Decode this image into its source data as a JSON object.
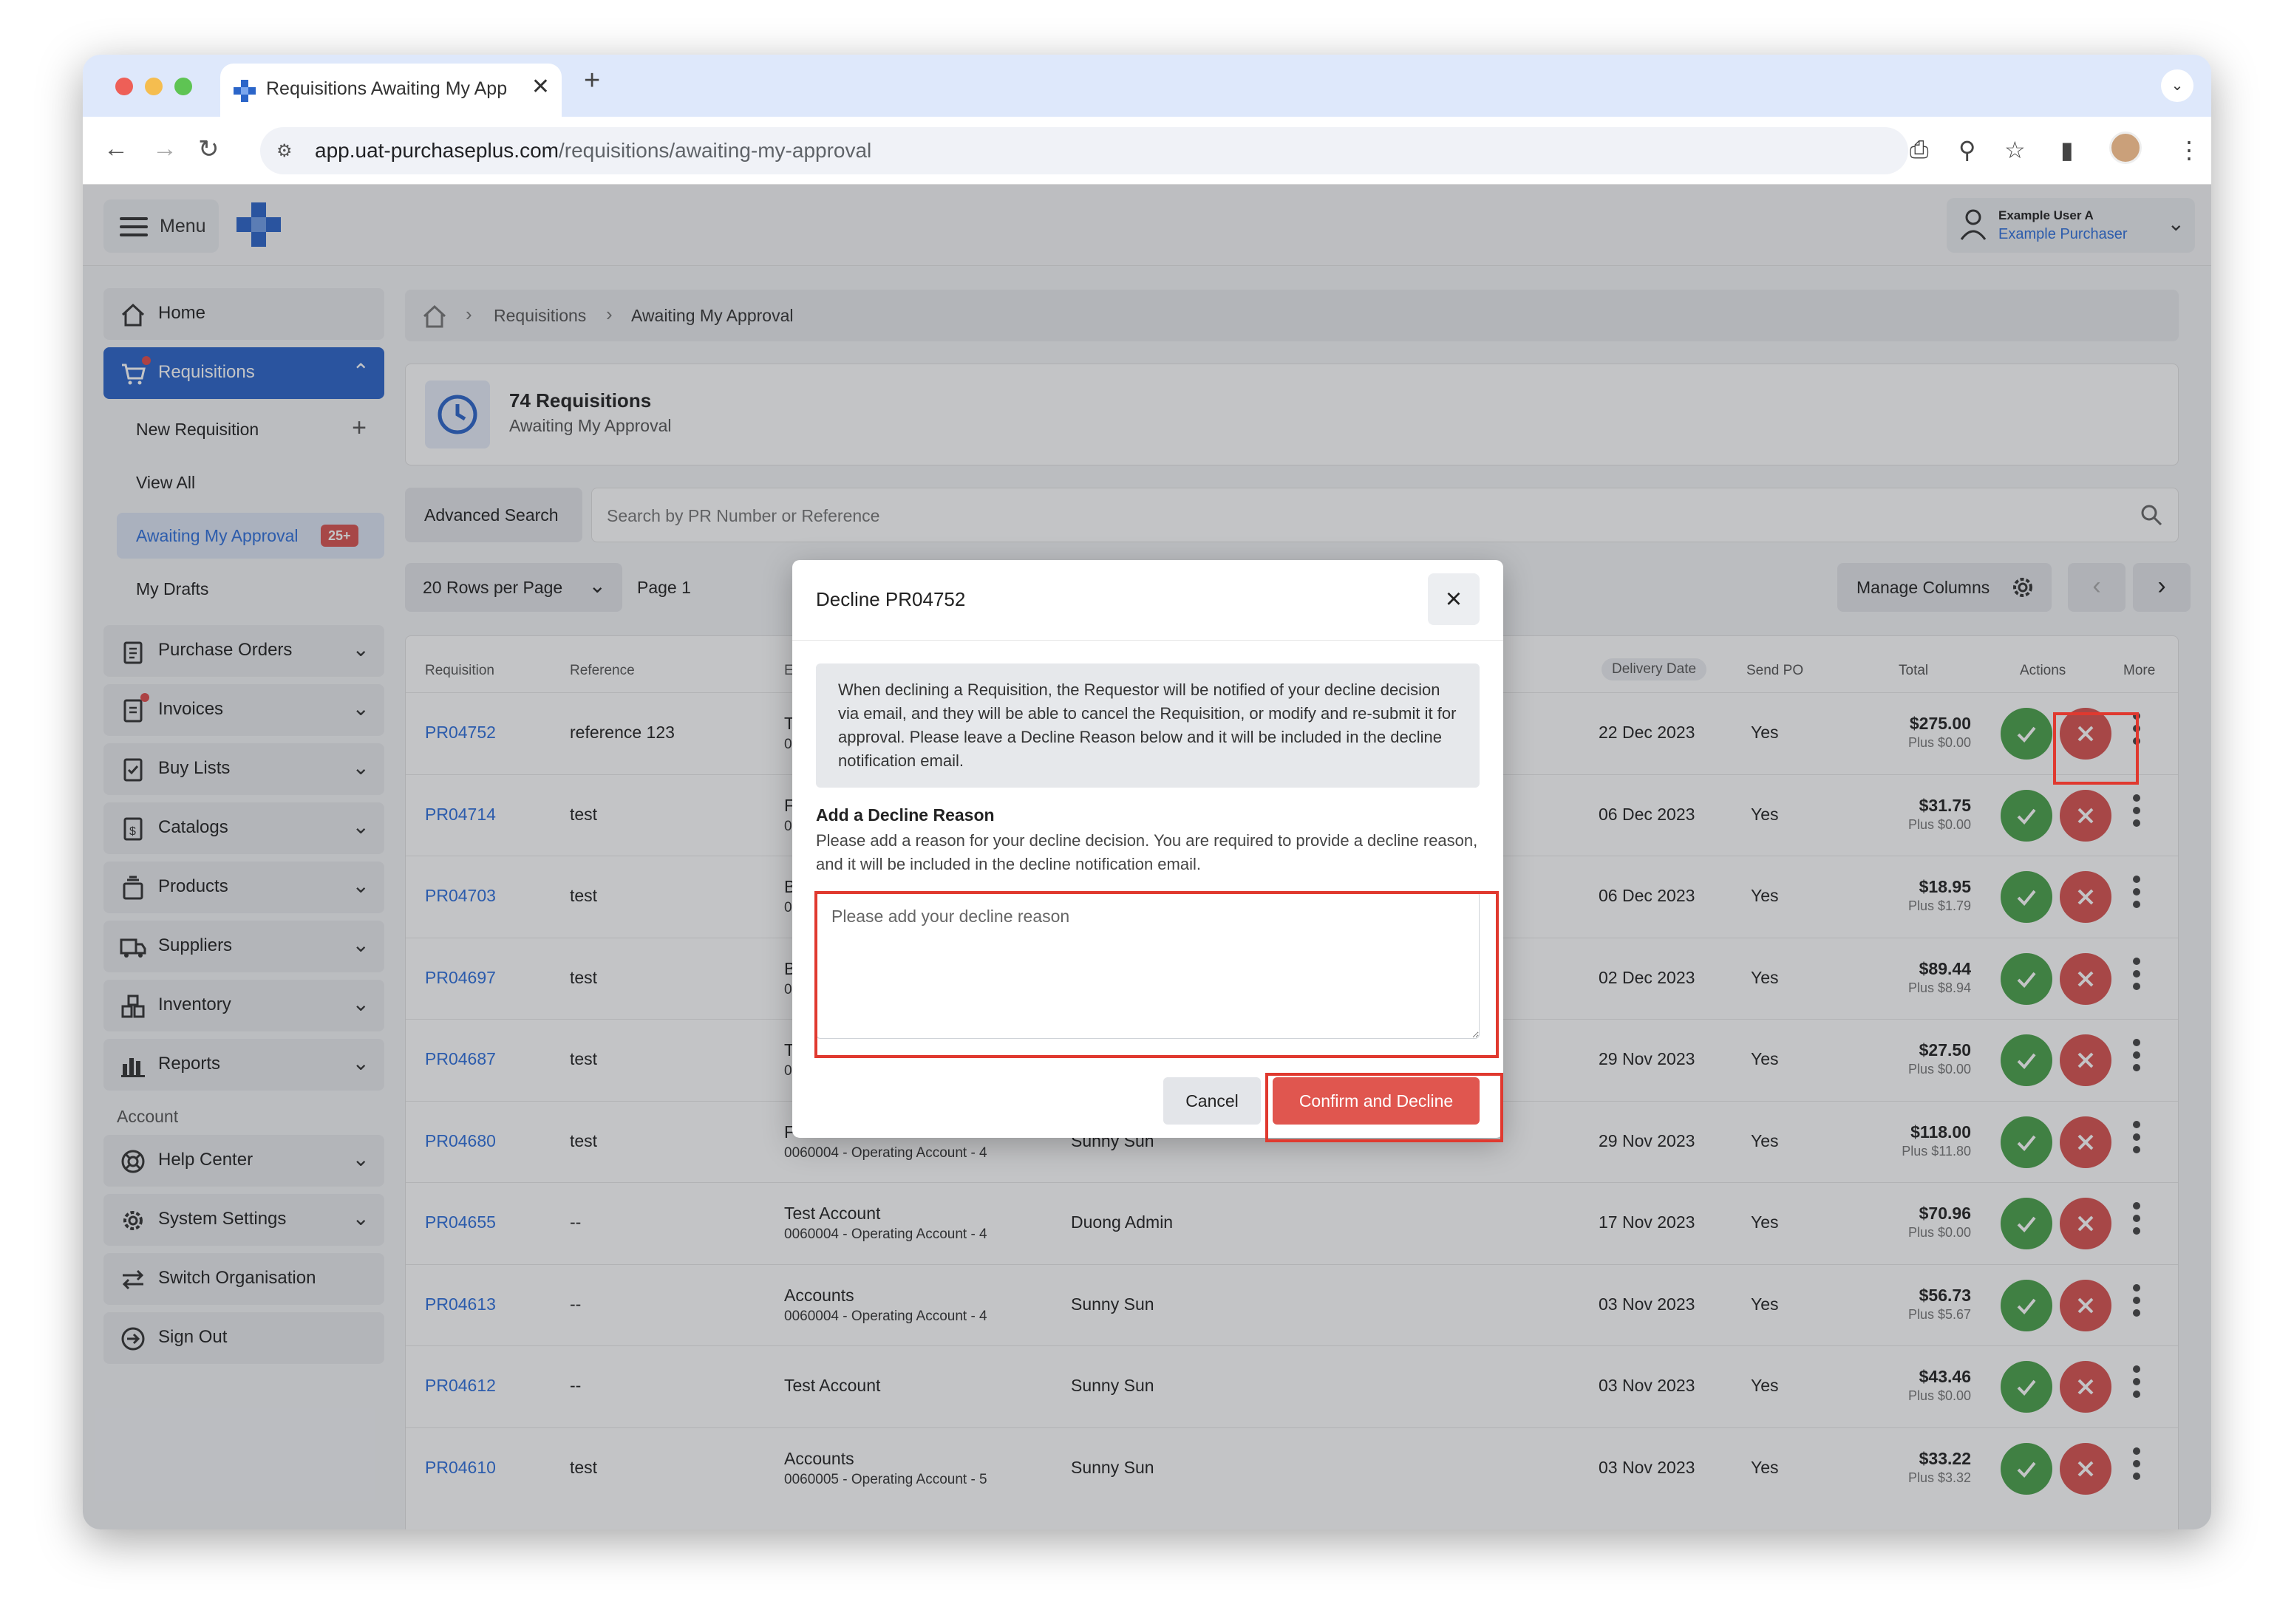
{
  "browser": {
    "tab_title": "Requisitions Awaiting My App",
    "url_domain": "app.uat-purchaseplus.com",
    "url_path": "/requisitions/awaiting-my-approval"
  },
  "header": {
    "menu_label": "Menu",
    "user_name": "Example User A",
    "user_role": "Example Purchaser"
  },
  "sidebar": {
    "home": "Home",
    "requisitions": "Requisitions",
    "new_requisition": "New Requisition",
    "view_all": "View All",
    "awaiting": "Awaiting My Approval",
    "awaiting_badge": "25+",
    "my_drafts": "My Drafts",
    "purchase_orders": "Purchase Orders",
    "invoices": "Invoices",
    "buy_lists": "Buy Lists",
    "catalogs": "Catalogs",
    "products": "Products",
    "suppliers": "Suppliers",
    "inventory": "Inventory",
    "reports": "Reports",
    "account_label": "Account",
    "help_center": "Help Center",
    "system_settings": "System Settings",
    "switch_org": "Switch Organisation",
    "sign_out": "Sign Out"
  },
  "breadcrumb": {
    "level1": "Requisitions",
    "level2": "Awaiting My Approval"
  },
  "summary": {
    "title": "74 Requisitions",
    "subtitle": "Awaiting My Approval"
  },
  "toolbar": {
    "advanced_search": "Advanced Search",
    "search_placeholder": "Search by PR Number or Reference",
    "rows_per_page": "20 Rows per Page",
    "page": "Page 1",
    "manage_columns": "Manage Columns"
  },
  "table": {
    "headers": {
      "requisition": "Requisition",
      "reference": "Reference",
      "account": "Ex",
      "delivery_date": "Delivery Date",
      "send_po": "Send PO",
      "total": "Total",
      "actions": "Actions",
      "more": "More"
    },
    "rows": [
      {
        "id": "PR04752",
        "ref": "reference 123",
        "acct": "T",
        "acct_sub": "0",
        "req": "",
        "date": "22 Dec 2023",
        "send": "Yes",
        "total": "$275.00",
        "plus": "Plus $0.00"
      },
      {
        "id": "PR04714",
        "ref": "test",
        "acct": "F",
        "acct_sub": "0",
        "req": "",
        "date": "06 Dec 2023",
        "send": "Yes",
        "total": "$31.75",
        "plus": "Plus $0.00"
      },
      {
        "id": "PR04703",
        "ref": "test",
        "acct": "B",
        "acct_sub": "0",
        "req": "",
        "date": "06 Dec 2023",
        "send": "Yes",
        "total": "$18.95",
        "plus": "Plus $1.79"
      },
      {
        "id": "PR04697",
        "ref": "test",
        "acct": "B",
        "acct_sub": "0",
        "req": "",
        "date": "02 Dec 2023",
        "send": "Yes",
        "total": "$89.44",
        "plus": "Plus $8.94"
      },
      {
        "id": "PR04687",
        "ref": "test",
        "acct": "T",
        "acct_sub": "0",
        "req": "",
        "date": "29 Nov 2023",
        "send": "Yes",
        "total": "$27.50",
        "plus": "Plus $0.00"
      },
      {
        "id": "PR04680",
        "ref": "test",
        "acct": "Food",
        "acct_sub": "0060004 - Operating Account - 4",
        "req": "Sunny Sun",
        "date": "29 Nov 2023",
        "send": "Yes",
        "total": "$118.00",
        "plus": "Plus $11.80"
      },
      {
        "id": "PR04655",
        "ref": "--",
        "acct": "Test Account",
        "acct_sub": "0060004 - Operating Account - 4",
        "req": "Duong Admin",
        "date": "17 Nov 2023",
        "send": "Yes",
        "total": "$70.96",
        "plus": "Plus $0.00"
      },
      {
        "id": "PR04613",
        "ref": "--",
        "acct": "Accounts",
        "acct_sub": "0060004 - Operating Account - 4",
        "req": "Sunny Sun",
        "date": "03 Nov 2023",
        "send": "Yes",
        "total": "$56.73",
        "plus": "Plus $5.67"
      },
      {
        "id": "PR04612",
        "ref": "--",
        "acct": "Test Account",
        "acct_sub": "",
        "req": "Sunny Sun",
        "date": "03 Nov 2023",
        "send": "Yes",
        "total": "$43.46",
        "plus": "Plus $0.00"
      },
      {
        "id": "PR04610",
        "ref": "test",
        "acct": "Accounts",
        "acct_sub": "0060005 - Operating Account - 5",
        "req": "Sunny Sun",
        "date": "03 Nov 2023",
        "send": "Yes",
        "total": "$33.22",
        "plus": "Plus $3.32"
      }
    ]
  },
  "modal": {
    "title": "Decline PR04752",
    "info": "When declining a Requisition, the Requestor will be notified of your decline decision via email, and they will be able to cancel the Requisition, or modify and re-submit it for approval. Please leave a Decline Reason below and it will be included in the decline notification email.",
    "label": "Add a Decline Reason",
    "help": "Please add a reason for your decline decision. You are required to provide a decline reason, and it will be included in the decline notification email.",
    "placeholder": "Please add your decline reason",
    "cancel": "Cancel",
    "confirm": "Confirm and Decline"
  },
  "colors": {
    "primary": "#2b65c9",
    "approve": "#4aa14a",
    "decline": "#d9534f",
    "highlight": "#e0392f"
  }
}
